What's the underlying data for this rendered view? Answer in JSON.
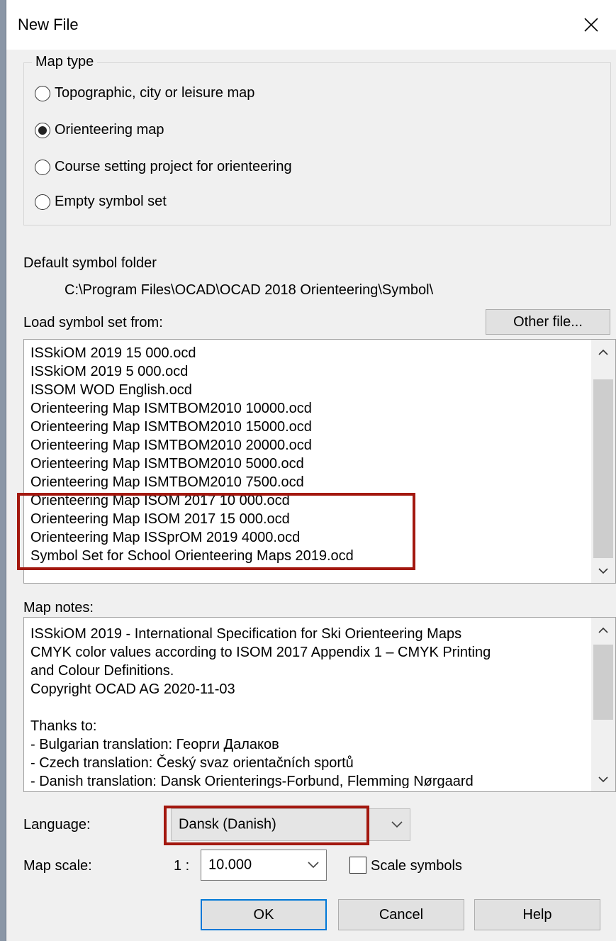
{
  "dialog": {
    "title": "New File"
  },
  "map_type": {
    "legend": "Map type",
    "options": [
      {
        "label": "Topographic, city or leisure map",
        "selected": false
      },
      {
        "label": "Orienteering map",
        "selected": true
      },
      {
        "label": "Course setting project for orienteering",
        "selected": false
      },
      {
        "label": "Empty symbol set",
        "selected": false
      }
    ]
  },
  "symbol_folder": {
    "label": "Default symbol folder",
    "path": "C:\\Program Files\\OCAD\\OCAD 2018 Orienteering\\Symbol\\"
  },
  "load_symbol_set": {
    "label": "Load symbol set from:",
    "other_file_button": "Other file...",
    "items": [
      "ISSkiOM 2019 15 000.ocd",
      "ISSkiOM 2019 5 000.ocd",
      "ISSOM WOD English.ocd",
      "Orienteering Map ISMTBOM2010 10000.ocd",
      "Orienteering Map ISMTBOM2010 15000.ocd",
      "Orienteering Map ISMTBOM2010 20000.ocd",
      "Orienteering Map ISMTBOM2010 5000.ocd",
      "Orienteering Map ISMTBOM2010 7500.ocd",
      "Orienteering Map ISOM 2017 10 000.ocd",
      "Orienteering Map ISOM 2017 15 000.ocd",
      "Orienteering Map ISSprOM 2019 4000.ocd",
      "Symbol Set for School Orienteering Maps 2019.ocd"
    ]
  },
  "map_notes": {
    "label": "Map notes:",
    "lines": [
      "ISSkiOM 2019 - International Specification for Ski Orienteering Maps",
      "CMYK color values according to ISOM 2017 Appendix 1 – CMYK Printing",
      "and Colour Definitions.",
      "Copyright OCAD AG 2020-11-03",
      "",
      "Thanks to:",
      "- Bulgarian translation: Георги Далаков",
      "- Czech translation: Český svaz orientačních sportů",
      "- Danish translation: Dansk Orienterings-Forbund, Flemming Nørgaard"
    ]
  },
  "language": {
    "label": "Language:",
    "value": "Dansk (Danish)"
  },
  "map_scale": {
    "label": "Map scale:",
    "prefix": "1 :",
    "value": "10.000",
    "scale_symbols_label": "Scale symbols",
    "scale_symbols_checked": false
  },
  "buttons": {
    "ok": "OK",
    "cancel": "Cancel",
    "help": "Help"
  },
  "colors": {
    "highlight": "#a3180f",
    "default_button_border": "#0078d7"
  }
}
